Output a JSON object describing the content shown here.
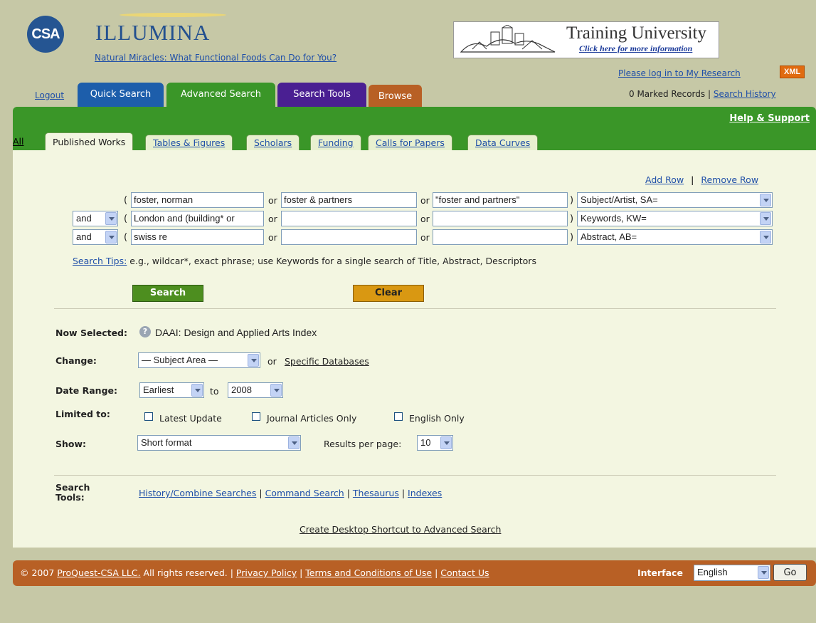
{
  "header": {
    "logo_text": "CSA",
    "brand": "ILLUMINA",
    "tagline": "Natural Miracles: What Functional Foods Can Do for You?",
    "banner_title": "Training University",
    "banner_sub": "Click here for more information",
    "login_link": "Please log in to My Research",
    "xml_badge": "XML",
    "logout": "Logout",
    "marked_records": "0 Marked Records",
    "separator": "|",
    "search_history": "Search History"
  },
  "tabs": {
    "quick": "Quick Search",
    "advanced": "Advanced Search",
    "tools": "Search Tools",
    "browse": "Browse"
  },
  "help_support": "Help & Support",
  "subtabs": {
    "all": "All",
    "published": "Published Works",
    "tables": "Tables & Figures",
    "scholars": "Scholars",
    "funding": "Funding",
    "calls": "Calls for Papers",
    "curves": "Data Curves"
  },
  "rows": {
    "add": "Add Row",
    "sep": "|",
    "remove": "Remove Row"
  },
  "search_rows": [
    {
      "bool": "",
      "term1": "foster, norman",
      "or1": "or",
      "term2": "foster & partners",
      "or2": "or",
      "term3": "\"foster and partners\"",
      "field": "Subject/Artist, SA="
    },
    {
      "bool": "and",
      "term1": "London and (building* or",
      "or1": "or",
      "term2": "",
      "or2": "or",
      "term3": "",
      "field": "Keywords, KW="
    },
    {
      "bool": "and",
      "term1": "swiss re",
      "or1": "or",
      "term2": "",
      "or2": "or",
      "term3": "",
      "field": "Abstract, AB="
    }
  ],
  "tips": {
    "link": "Search Tips:",
    "text": " e.g., wildcar*, exact phrase; use Keywords for a single search of Title, Abstract, Descriptors"
  },
  "buttons": {
    "search": "Search",
    "clear": "Clear",
    "go": "Go"
  },
  "options": {
    "now_selected_label": "Now Selected:",
    "now_selected_value": "DAAI: Design and Applied Arts Index",
    "change_label": "Change:",
    "subject_area": "— Subject Area —",
    "or": "or",
    "specific_databases": "Specific Databases",
    "date_range_label": "Date Range:",
    "date_from": "Earliest",
    "to": "to",
    "date_to": "2008",
    "limited_label": "Limited to:",
    "latest_update": "Latest Update",
    "journal_only": "Journal Articles Only",
    "english_only": "English Only",
    "show_label": "Show:",
    "show_format": "Short format",
    "results_per_page": "Results per page:",
    "results_value": "10"
  },
  "search_tools": {
    "label_line1": "Search",
    "label_line2": "Tools:",
    "history": "History/Combine Searches",
    "command": "Command Search",
    "thesaurus": "Thesaurus",
    "indexes": "Indexes",
    "sep": "|",
    "shortcut": "Create Desktop Shortcut to Advanced Search"
  },
  "footer": {
    "copyright": "© 2007",
    "company": "ProQuest-CSA LLC.",
    "rights": "All rights reserved. |",
    "privacy": "Privacy Policy",
    "sep": "|",
    "terms": "Terms and Conditions of Use",
    "sep2": "|",
    "contact": "Contact Us",
    "interface_label": "Interface",
    "language": "English"
  }
}
